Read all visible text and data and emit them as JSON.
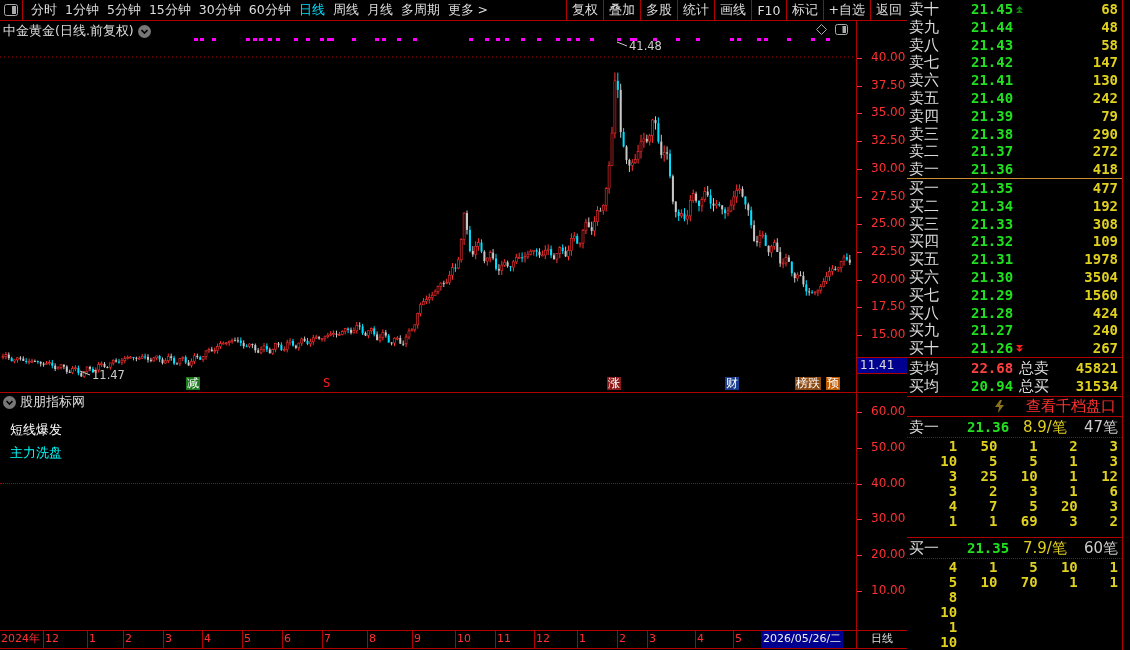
{
  "toolbar": {
    "periods": [
      {
        "label": "分时",
        "selected": false
      },
      {
        "label": "1分钟",
        "selected": false
      },
      {
        "label": "5分钟",
        "selected": false
      },
      {
        "label": "15分钟",
        "selected": false
      },
      {
        "label": "30分钟",
        "selected": false
      },
      {
        "label": "60分钟",
        "selected": false
      },
      {
        "label": "日线",
        "selected": true
      },
      {
        "label": "周线",
        "selected": false
      },
      {
        "label": "月线",
        "selected": false
      },
      {
        "label": "多周期",
        "selected": false
      },
      {
        "label": "更多 >",
        "selected": false
      }
    ],
    "buttons": [
      "复权",
      "叠加",
      "多股",
      "统计",
      "画线",
      "F10",
      "标记",
      "+自选",
      "返回"
    ]
  },
  "main_chart": {
    "title": "中金黄金(日线.前复权)",
    "high_label": "41.48",
    "low_label": "11.47",
    "price_ticks": [
      "40.00",
      "37.50",
      "35.00",
      "32.50",
      "30.00",
      "27.50",
      "25.00",
      "22.50",
      "20.00",
      "17.50",
      "15.00"
    ],
    "current_price": "11.41",
    "events": [
      {
        "label": "减",
        "color": "#1c7a1c"
      },
      {
        "label": "S",
        "color": "#000000"
      },
      {
        "label": "涨",
        "color": "#8a1a1a"
      },
      {
        "label": "财",
        "color": "#1a3c8c"
      },
      {
        "label": "榜跌",
        "color": "#8b4a13"
      },
      {
        "label": "预",
        "color": "#c05a00"
      }
    ]
  },
  "indicator": {
    "title": "股朋指标网",
    "lines": [
      {
        "label": "短线爆发",
        "color": "#ffffff"
      },
      {
        "label": "主力洗盘",
        "color": "#00ffff"
      }
    ],
    "ticks": [
      "60.00",
      "50.00",
      "40.00",
      "30.00",
      "20.00",
      "10.00"
    ]
  },
  "time_axis": {
    "labels": [
      "2024年",
      "12",
      "1",
      "2",
      "3",
      "4",
      "5",
      "6",
      "7",
      "8",
      "9",
      "10",
      "11",
      "12",
      "1",
      "2",
      "3",
      "4",
      "5"
    ],
    "cursor_date": "2026/05/26/二",
    "period": "日线"
  },
  "order_book": {
    "asks": [
      {
        "label": "卖十",
        "price": "21.45",
        "volume": "68"
      },
      {
        "label": "卖九",
        "price": "21.44",
        "volume": "48"
      },
      {
        "label": "卖八",
        "price": "21.43",
        "volume": "58"
      },
      {
        "label": "卖七",
        "price": "21.42",
        "volume": "147"
      },
      {
        "label": "卖六",
        "price": "21.41",
        "volume": "130"
      },
      {
        "label": "卖五",
        "price": "21.40",
        "volume": "242"
      },
      {
        "label": "卖四",
        "price": "21.39",
        "volume": "79"
      },
      {
        "label": "卖三",
        "price": "21.38",
        "volume": "290"
      },
      {
        "label": "卖二",
        "price": "21.37",
        "volume": "272"
      },
      {
        "label": "卖一",
        "price": "21.36",
        "volume": "418"
      }
    ],
    "bids": [
      {
        "label": "买一",
        "price": "21.35",
        "volume": "477"
      },
      {
        "label": "买二",
        "price": "21.34",
        "volume": "192"
      },
      {
        "label": "买三",
        "price": "21.33",
        "volume": "308"
      },
      {
        "label": "买四",
        "price": "21.32",
        "volume": "109"
      },
      {
        "label": "买五",
        "price": "21.31",
        "volume": "1978"
      },
      {
        "label": "买六",
        "price": "21.30",
        "volume": "3504"
      },
      {
        "label": "买七",
        "price": "21.29",
        "volume": "1560"
      },
      {
        "label": "买八",
        "price": "21.28",
        "volume": "424"
      },
      {
        "label": "买九",
        "price": "21.27",
        "volume": "240"
      },
      {
        "label": "买十",
        "price": "21.26",
        "volume": "267"
      }
    ],
    "averages": [
      {
        "label": "卖均",
        "price": "22.68",
        "color": "#ff4040",
        "total_label": "总卖",
        "total": "45821"
      },
      {
        "label": "买均",
        "price": "20.94",
        "color": "#20e020",
        "total_label": "总买",
        "total": "31534"
      }
    ],
    "link": "查看千档盘口",
    "queues": [
      {
        "label": "卖一",
        "price": "21.36",
        "avg": "8.9/笔",
        "count": "47笔",
        "rows": [
          [
            "1",
            "50",
            "1",
            "2",
            "3"
          ],
          [
            "10",
            "5",
            "5",
            "1",
            "3"
          ],
          [
            "3",
            "25",
            "10",
            "1",
            "12"
          ],
          [
            "3",
            "2",
            "3",
            "1",
            "6"
          ],
          [
            "4",
            "7",
            "5",
            "20",
            "3"
          ],
          [
            "1",
            "1",
            "69",
            "3",
            "2"
          ]
        ]
      },
      {
        "label": "买一",
        "price": "21.35",
        "avg": "7.9/笔",
        "count": "60笔",
        "rows": [
          [
            "4",
            "1",
            "5",
            "10",
            "1"
          ],
          [
            "5",
            "10",
            "70",
            "1",
            "1"
          ],
          [
            "8"
          ],
          [
            "10"
          ],
          [
            "1"
          ],
          [
            "10"
          ]
        ]
      }
    ]
  }
}
